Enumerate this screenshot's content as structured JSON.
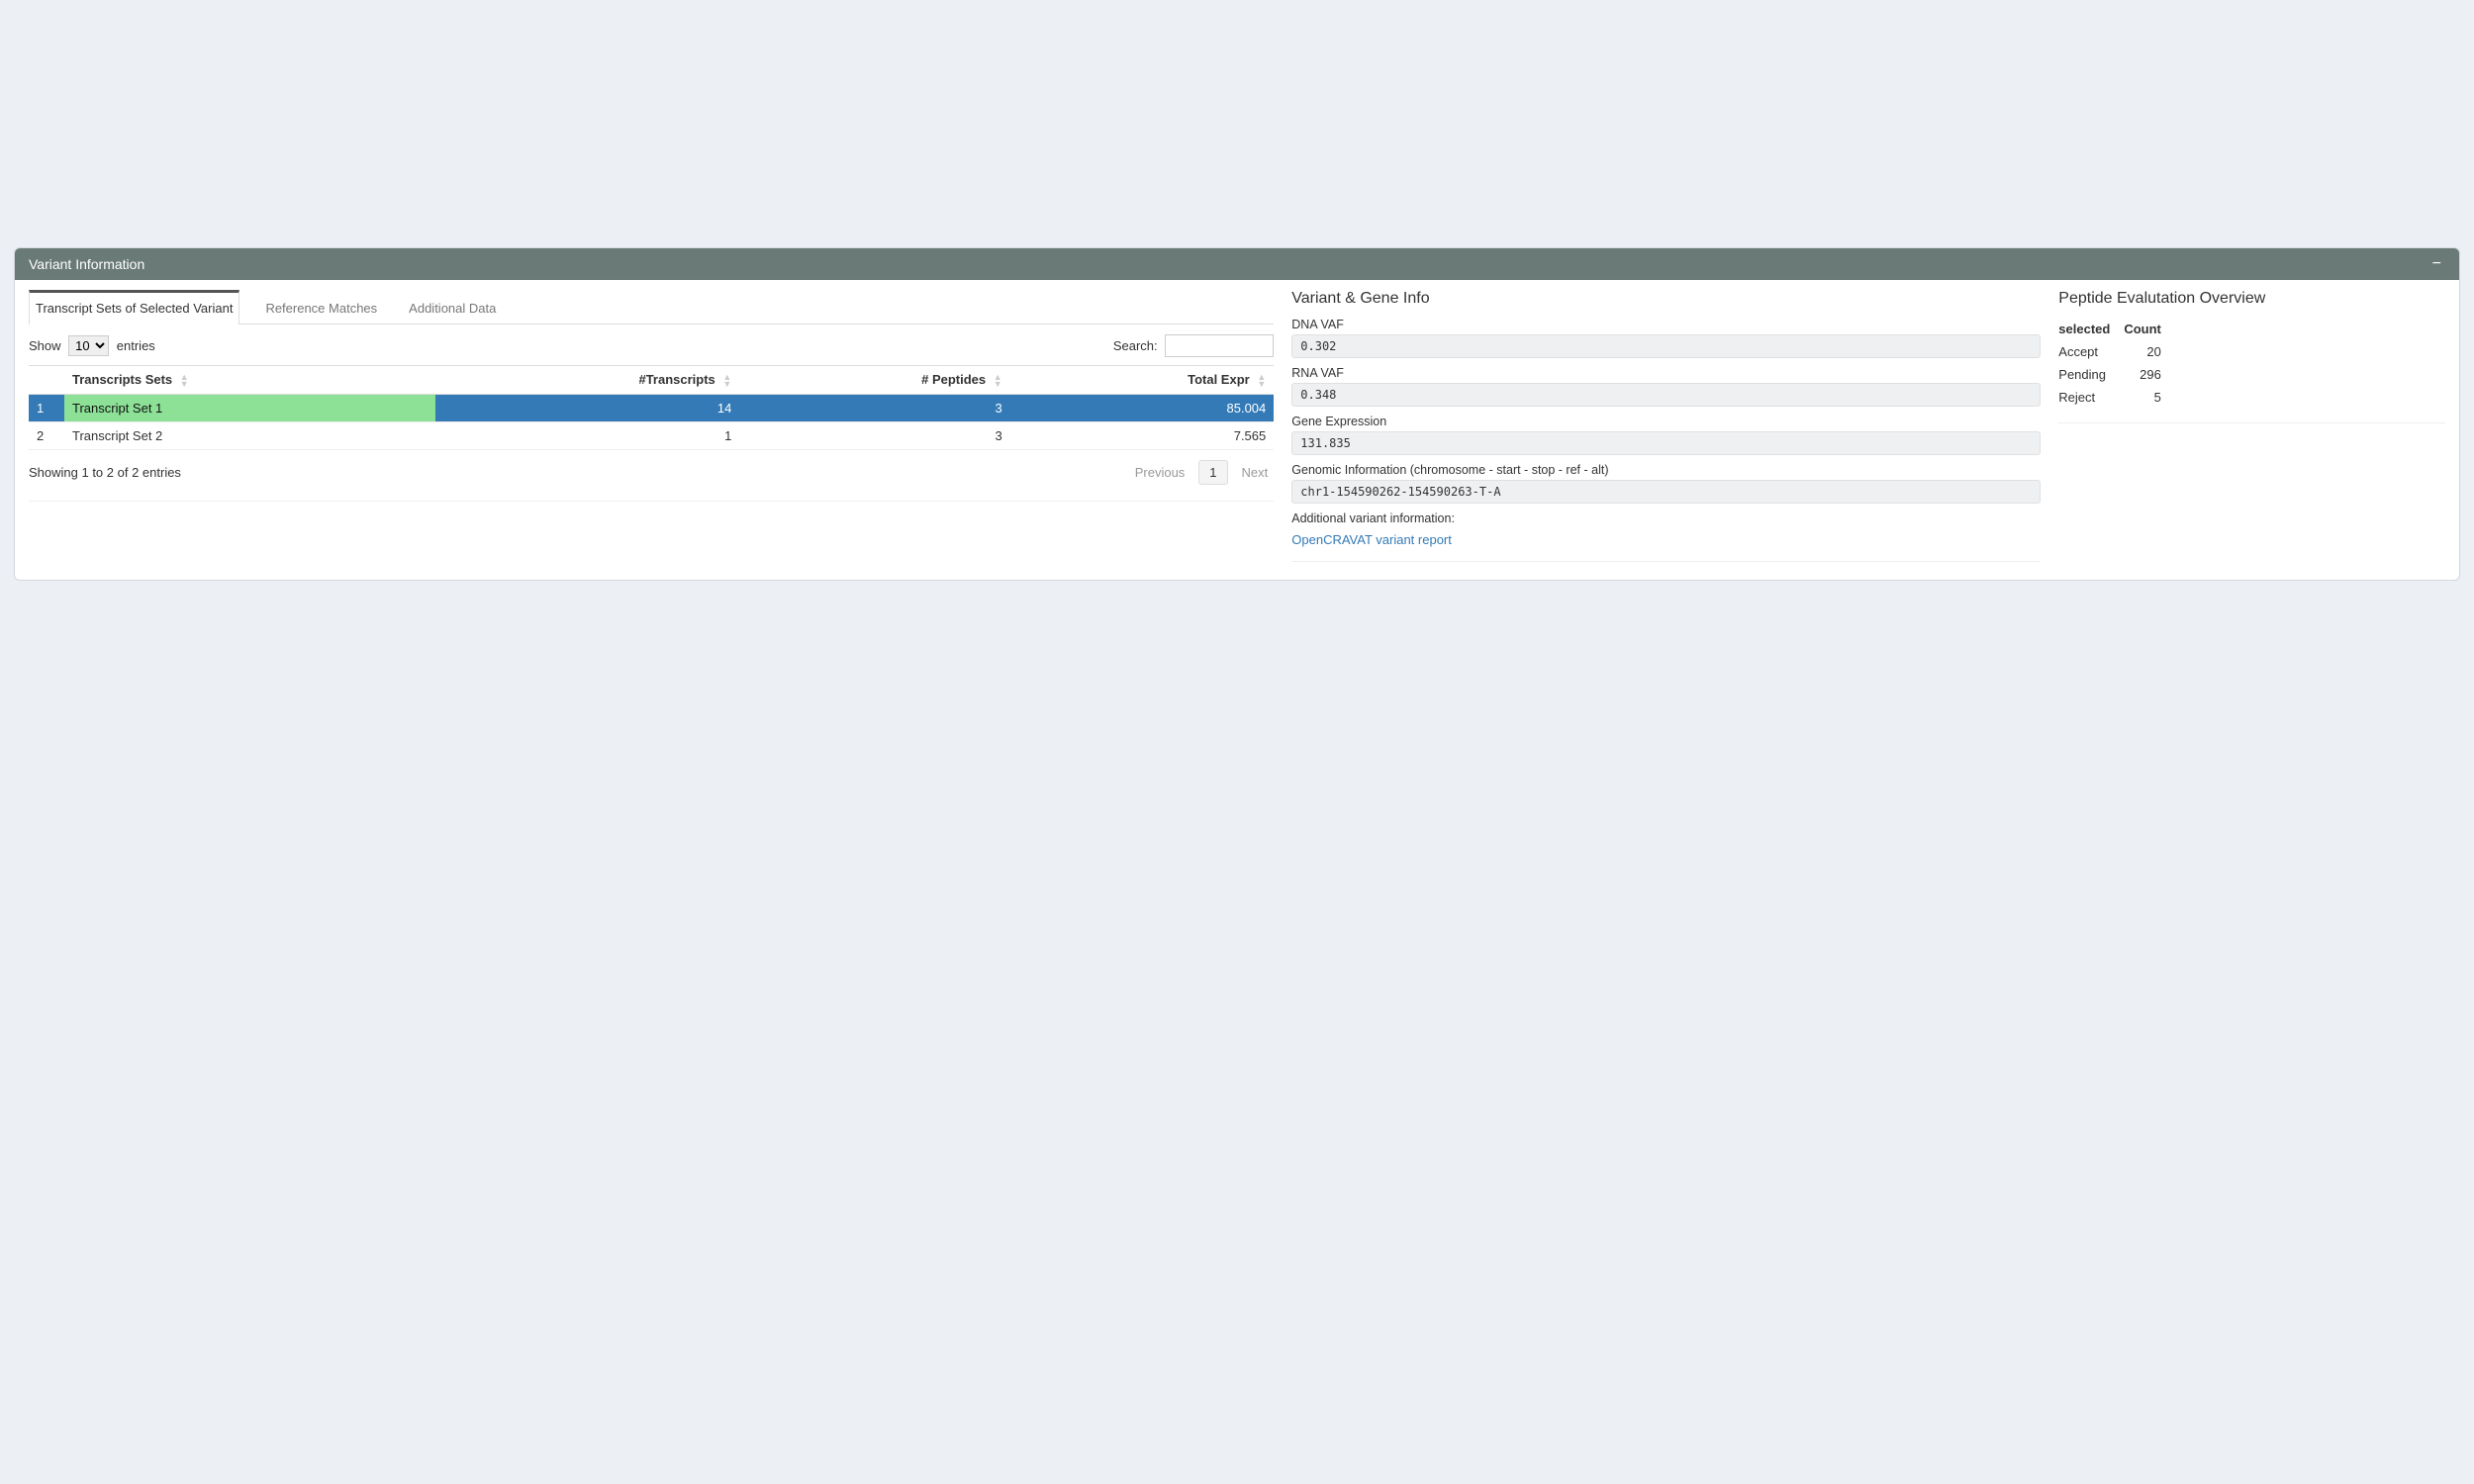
{
  "panel": {
    "title": "Variant Information"
  },
  "tabs": [
    {
      "label": "Transcript Sets of Selected Variant",
      "active": true
    },
    {
      "label": "Reference Matches",
      "active": false
    },
    {
      "label": "Additional Data",
      "active": false
    }
  ],
  "datatable": {
    "show_label_pre": "Show",
    "show_label_post": "entries",
    "length_value": "10",
    "search_label": "Search:",
    "search_value": "",
    "columns": [
      "",
      "Transcripts Sets",
      "#Transcripts",
      "# Peptides",
      "Total Expr"
    ],
    "rows": [
      {
        "idx": "1",
        "name": "Transcript Set 1",
        "transcripts": "14",
        "peptides": "3",
        "expr": "85.004",
        "selected": true
      },
      {
        "idx": "2",
        "name": "Transcript Set 2",
        "transcripts": "1",
        "peptides": "3",
        "expr": "7.565",
        "selected": false
      }
    ],
    "info_text": "Showing 1 to 2 of 2 entries",
    "prev_label": "Previous",
    "page_number": "1",
    "next_label": "Next"
  },
  "gene_info": {
    "title": "Variant & Gene Info",
    "dna_vaf_label": "DNA VAF",
    "dna_vaf": "0.302",
    "rna_vaf_label": "RNA VAF",
    "rna_vaf": "0.348",
    "gene_expr_label": "Gene Expression",
    "gene_expr": "131.835",
    "genomic_label": "Genomic Information (chromosome - start - stop - ref - alt)",
    "genomic": "chr1-154590262-154590263-T-A",
    "additional_label": "Additional variant information:",
    "link_text": "OpenCRAVAT variant report"
  },
  "peptide_overview": {
    "title": "Peptide Evalutation Overview",
    "col_selected": "selected",
    "col_count": "Count",
    "rows": [
      {
        "label": "Accept",
        "count": "20"
      },
      {
        "label": "Pending",
        "count": "296"
      },
      {
        "label": "Reject",
        "count": "5"
      }
    ]
  }
}
